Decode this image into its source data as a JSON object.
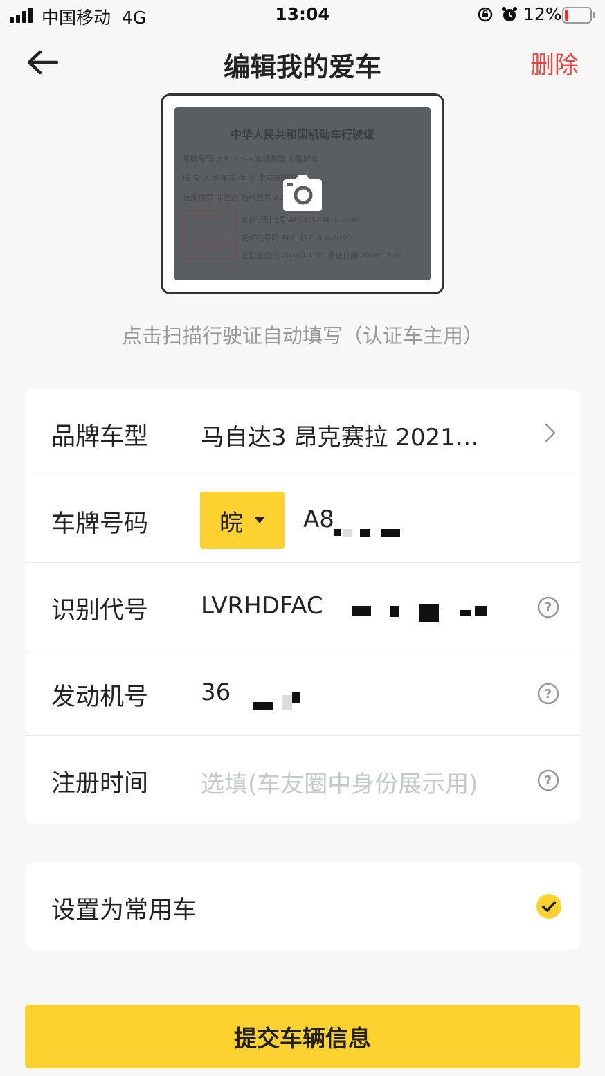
{
  "status_bar": {
    "carrier": "中国移动",
    "network": "4G",
    "time": "13:04",
    "battery": "12%",
    "icons": [
      "signal-icon",
      "rotation-lock-icon",
      "alarm-icon",
      "battery-low-icon"
    ]
  },
  "header": {
    "title": "编辑我的爱车",
    "delete_label": "删除",
    "back_icon": "back-arrow-icon"
  },
  "license_card": {
    "title": "中华人民共和国机动车行驶证",
    "rows": [
      "号牌号码  京A12345        车辆类型  小型轿车",
      "所 有 人  楊车帝          住    址  北京市朝阳区",
      "使用性质  非营运                     品牌型号  ABCDE",
      "车辆识别代号  ABCD1234567890",
      "发动机号码  ABCD1234567890",
      "注册登记日  2018.01.01     发证日期  2018.01.01"
    ],
    "stamp": [
      "北京市公",
      "安局公安",
      "交通管理局"
    ],
    "icon": "camera-icon"
  },
  "scan_hint": "点击扫描行驶证自动填写（认证车主用）",
  "form": {
    "brand_label": "品牌车型",
    "brand_value": "马自达3 昂克赛拉 2021…",
    "plate_label": "车牌号码",
    "plate_province": "皖",
    "plate_value": "A8",
    "vin_label": "识别代号",
    "vin_value": "LVRHDFAC",
    "engine_label": "发动机号",
    "engine_value": "36",
    "reg_label": "注册时间",
    "reg_placeholder": "选填(车友圈中身份展示用)"
  },
  "default_car": {
    "label": "设置为常用车",
    "checked": true
  },
  "submit_label": "提交车辆信息",
  "colors": {
    "accent": "#fdd12f",
    "delete": "#f0413b",
    "placeholder": "#c6c8cc",
    "background": "#f7f7f8"
  }
}
